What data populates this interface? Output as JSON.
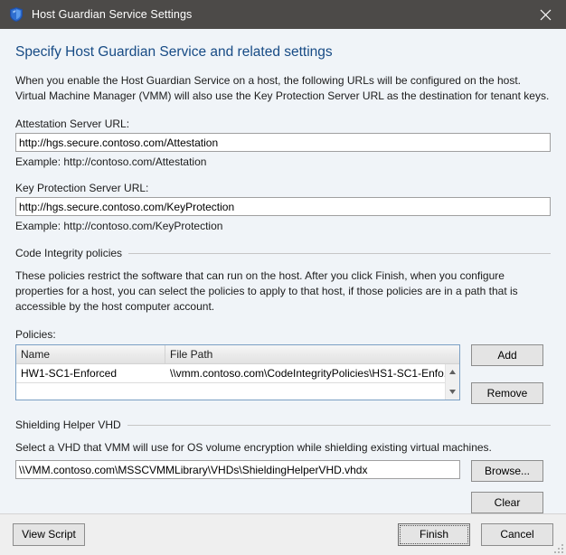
{
  "window": {
    "title": "Host Guardian Service Settings",
    "icon": "shield-icon",
    "close_label": "✕",
    "titlebar_color": "#4c4a48",
    "accent_color": "#174b85"
  },
  "page": {
    "heading": "Specify Host Guardian Service and related settings",
    "intro_line1": "When you enable the Host Guardian Service on a host, the following URLs will be configured on the host.",
    "intro_line2": "Virtual Machine Manager (VMM) will also use the Key Protection Server URL as the destination for tenant keys."
  },
  "attestation": {
    "label": "Attestation Server URL:",
    "value": "http://hgs.secure.contoso.com/Attestation",
    "placeholder": "",
    "example": "Example: http://contoso.com/Attestation"
  },
  "key_protection": {
    "label": "Key Protection Server URL:",
    "value": "http://hgs.secure.contoso.com/KeyProtection",
    "placeholder": "",
    "example": "Example: http://contoso.com/KeyProtection"
  },
  "code_integrity": {
    "group_label": "Code Integrity policies",
    "description_line1": "These policies restrict the software that can run on the host. After you click Finish, when you configure",
    "description_line2": "properties for a host, you can select the policies to apply to that host, if those policies are in a path that is",
    "description_line3": "accessible by the host computer account.",
    "policies_label": "Policies:",
    "table": {
      "columns": [
        "Name",
        "File Path"
      ],
      "rows": [
        {
          "name": "HW1-SC1-Enforced",
          "path": "\\\\vmm.contoso.com\\CodeIntegrityPolicies\\HS1-SC1-Enfo..."
        }
      ]
    },
    "add_label": "Add",
    "remove_label": "Remove"
  },
  "shielding_vhd": {
    "group_label": "Shielding Helper VHD",
    "description": "Select a VHD that VMM will use for OS volume encryption while shielding existing virtual machines.",
    "value": "\\\\VMM.contoso.com\\MSSCVMMLibrary\\VHDs\\ShieldingHelperVHD.vhdx",
    "placeholder": "",
    "browse_label": "Browse...",
    "clear_label": "Clear"
  },
  "footer": {
    "view_script_label": "View Script",
    "finish_label": "Finish",
    "cancel_label": "Cancel"
  }
}
